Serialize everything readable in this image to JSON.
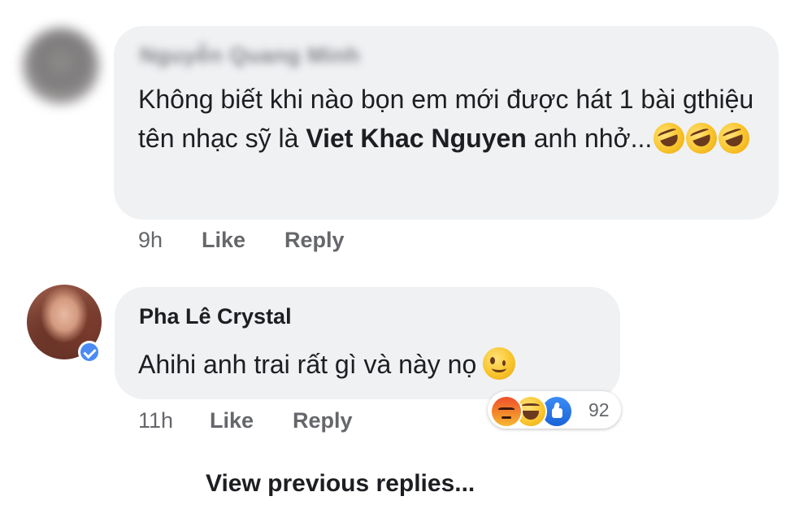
{
  "comments": [
    {
      "author": "Nguyễn Quang Minh",
      "author_blurred": true,
      "text_before": "Không biết khi nào bọn em mới được hát 1 bài gthiệu tên nhạc sỹ là ",
      "text_bold": "Viet Khac Nguyen",
      "text_after": " anh nhở...",
      "emojis": [
        "rolling-on-floor-laughing",
        "rolling-on-floor-laughing",
        "rolling-on-floor-laughing"
      ],
      "time": "9h",
      "like_label": "Like",
      "reply_label": "Reply"
    },
    {
      "author": "Pha Lê Crystal",
      "verified": true,
      "text": "Ahihi anh trai rất gì và này nọ",
      "emoji": "winking-face",
      "time": "11h",
      "like_label": "Like",
      "reply_label": "Reply",
      "reactions": {
        "types": [
          "angry",
          "haha",
          "like"
        ],
        "count": "92"
      }
    }
  ],
  "view_previous_label": "View previous replies..."
}
